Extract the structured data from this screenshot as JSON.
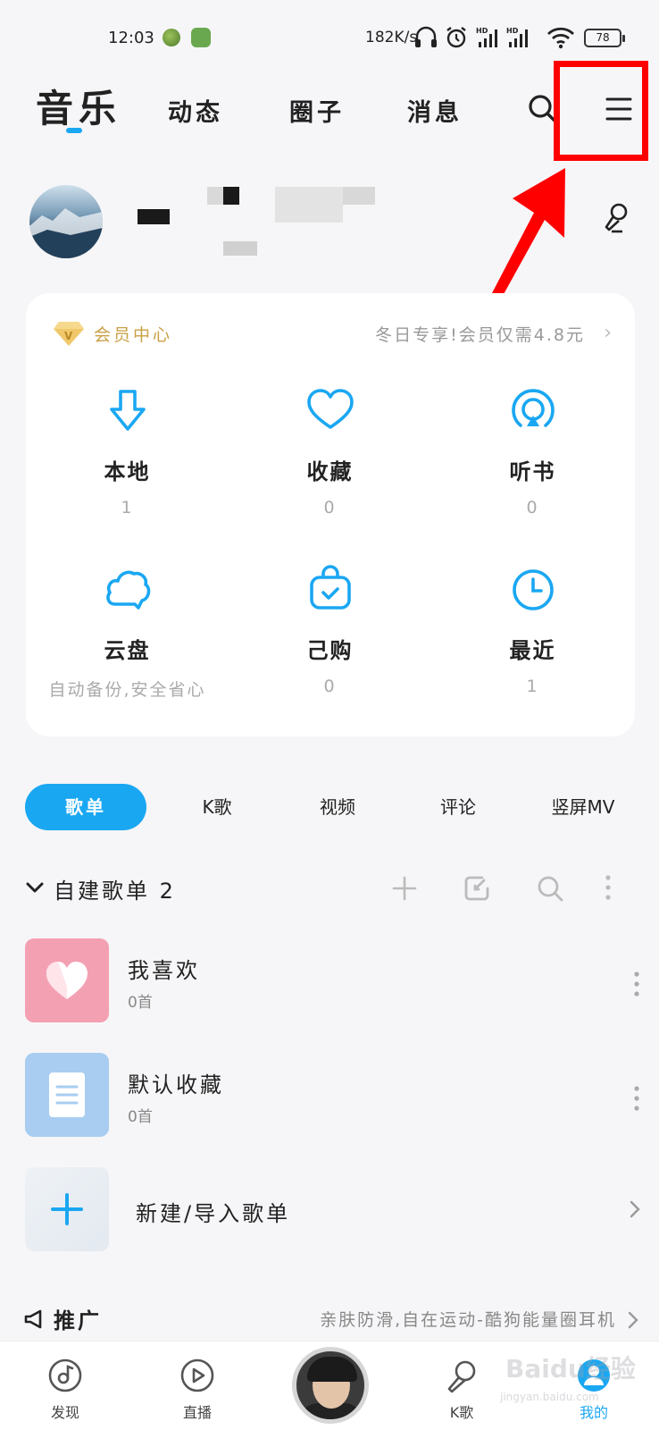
{
  "status_bar": {
    "time": "12:03",
    "net_rate": "182K/s",
    "battery": "78",
    "signal_label": "HD"
  },
  "top_nav": {
    "main_tab": "音乐",
    "tabs": [
      "动态",
      "圈子",
      "消息"
    ]
  },
  "vip": {
    "title": "会员中心",
    "promo": "冬日专享!会员仅需4.8元"
  },
  "quick_grid": [
    {
      "label": "本地",
      "count": "1",
      "icon": "download-icon"
    },
    {
      "label": "收藏",
      "count": "0",
      "icon": "heart-icon"
    },
    {
      "label": "听书",
      "count": "0",
      "icon": "audiobook-icon"
    },
    {
      "label": "云盘",
      "count": "自动备份,安全省心",
      "icon": "cloud-icon"
    },
    {
      "label": "己购",
      "count": "0",
      "icon": "purchase-bag-icon"
    },
    {
      "label": "最近",
      "count": "1",
      "icon": "clock-icon"
    }
  ],
  "sub_tabs": [
    "歌单",
    "K歌",
    "视频",
    "评论",
    "竖屏MV"
  ],
  "playlists": {
    "section_title": "自建歌单",
    "section_count": "2",
    "items": [
      {
        "name": "我喜欢",
        "count": "0首"
      },
      {
        "name": "默认收藏",
        "count": "0首"
      }
    ],
    "new_label": "新建/导入歌单"
  },
  "promo": {
    "title": "推广",
    "desc": "亲肤防滑,自在运动-酷狗能量圈耳机"
  },
  "bottom_nav": [
    "发现",
    "直播",
    "K歌",
    "我的"
  ],
  "watermark": {
    "main": "Baidu经验",
    "sub": "jingyan.baidu.com"
  },
  "colors": {
    "accent": "#1aa7f2",
    "vip_gold": "#c9a045",
    "highlight_red": "#ff0000"
  }
}
